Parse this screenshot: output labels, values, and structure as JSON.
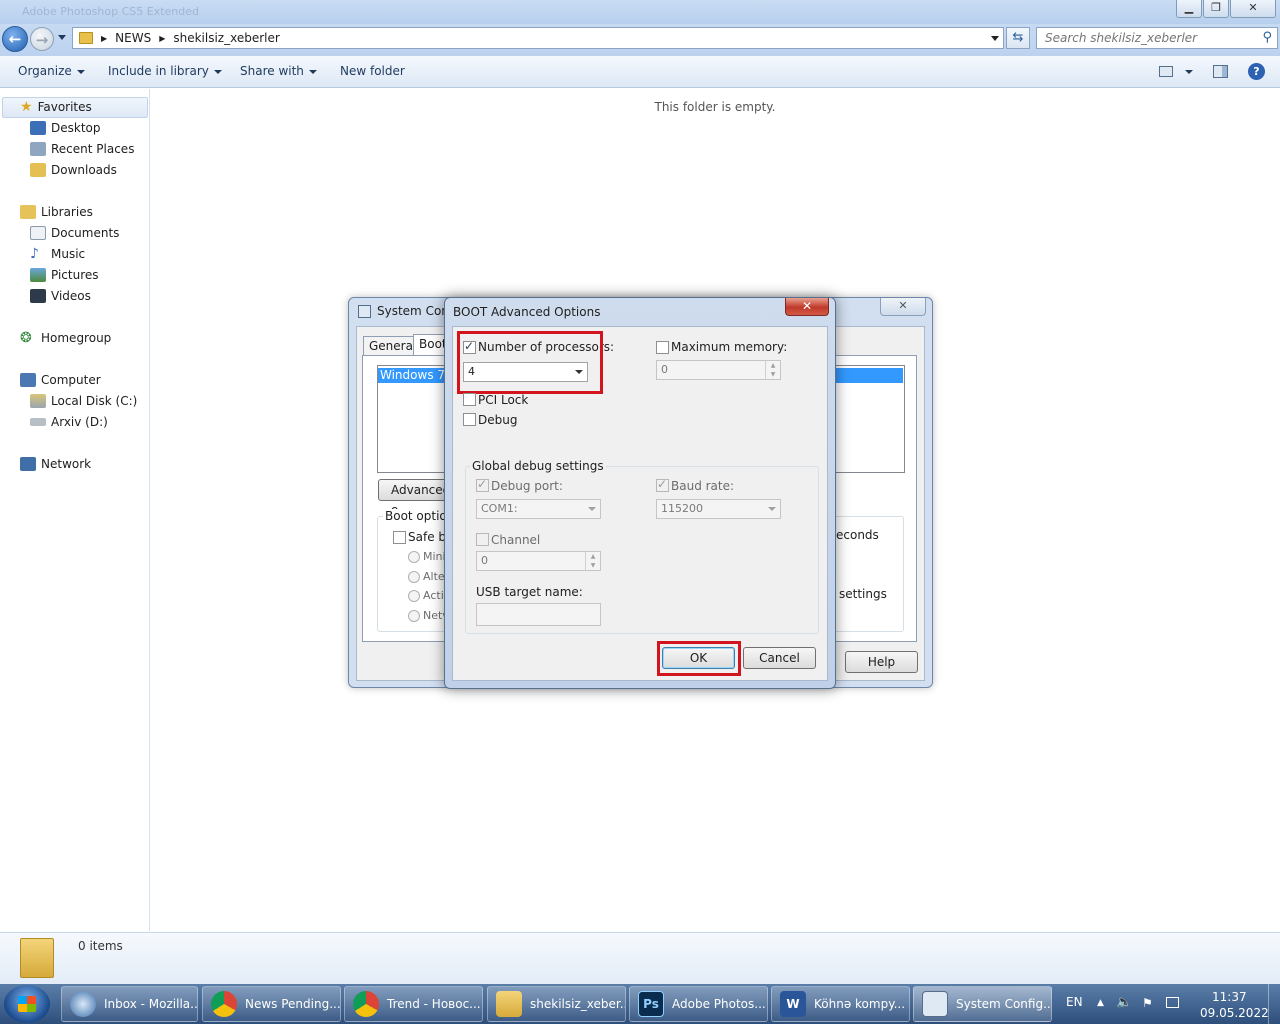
{
  "explorer": {
    "title": "Adobe Photoshop CS5 Extended",
    "address": {
      "crumbs": [
        "NEWS",
        "shekilsiz_xeberler"
      ]
    },
    "search_placeholder": "Search shekilsiz_xeberler",
    "toolbar": {
      "organize": "Organize",
      "include": "Include in library",
      "share": "Share with",
      "new_folder": "New folder"
    },
    "nav": {
      "favorites": "Favorites",
      "desktop": "Desktop",
      "recent": "Recent Places",
      "downloads": "Downloads",
      "libraries": "Libraries",
      "documents": "Documents",
      "music": "Music",
      "pictures": "Pictures",
      "videos": "Videos",
      "homegroup": "Homegroup",
      "computer": "Computer",
      "local_disk": "Local Disk (C:)",
      "arxiv": "Arxiv (D:)",
      "network": "Network"
    },
    "empty_message": "This folder is empty.",
    "details_count": "0 items"
  },
  "sysconf": {
    "title": "System Conf",
    "tabs": {
      "general": "General",
      "boot": "Boot"
    },
    "os_entry": "Windows 7 (C",
    "advanced_btn": "Advanced o",
    "boot_options": "Boot options",
    "safe_boot": "Safe bo",
    "radios": [
      "Mini",
      "Alter",
      "Activ",
      "Netv"
    ],
    "seconds": "econds",
    "settings": "settings",
    "help": "Help"
  },
  "advanced": {
    "title": "BOOT Advanced Options",
    "num_processors": {
      "label": "Number of processors:",
      "checked": true,
      "value": "4"
    },
    "max_memory": {
      "label": "Maximum memory:",
      "checked": false,
      "value": "0"
    },
    "pci_lock": "PCI Lock",
    "debug": "Debug",
    "global_debug": "Global debug settings",
    "debug_port": {
      "label": "Debug port:",
      "value": "COM1:"
    },
    "baud_rate": {
      "label": "Baud rate:",
      "value": "115200"
    },
    "channel": {
      "label": "Channel",
      "value": "0"
    },
    "usb_target": "USB target name:",
    "ok": "OK",
    "cancel": "Cancel"
  },
  "taskbar": {
    "items": [
      {
        "label": "Inbox - Mozilla...",
        "icon": "thunderbird-icon"
      },
      {
        "label": "News Pending...",
        "icon": "chrome-icon"
      },
      {
        "label": "Trend - Новос...",
        "icon": "chrome-icon"
      },
      {
        "label": "shekilsiz_xeber...",
        "icon": "folder-icon"
      },
      {
        "label": "Adobe Photos...",
        "icon": "photoshop-icon"
      },
      {
        "label": "Köhnə kompy...",
        "icon": "word-icon"
      },
      {
        "label": "System Config...",
        "icon": "msconfig-icon"
      }
    ],
    "lang": "EN",
    "time": "11:37",
    "date": "09.05.2022"
  }
}
